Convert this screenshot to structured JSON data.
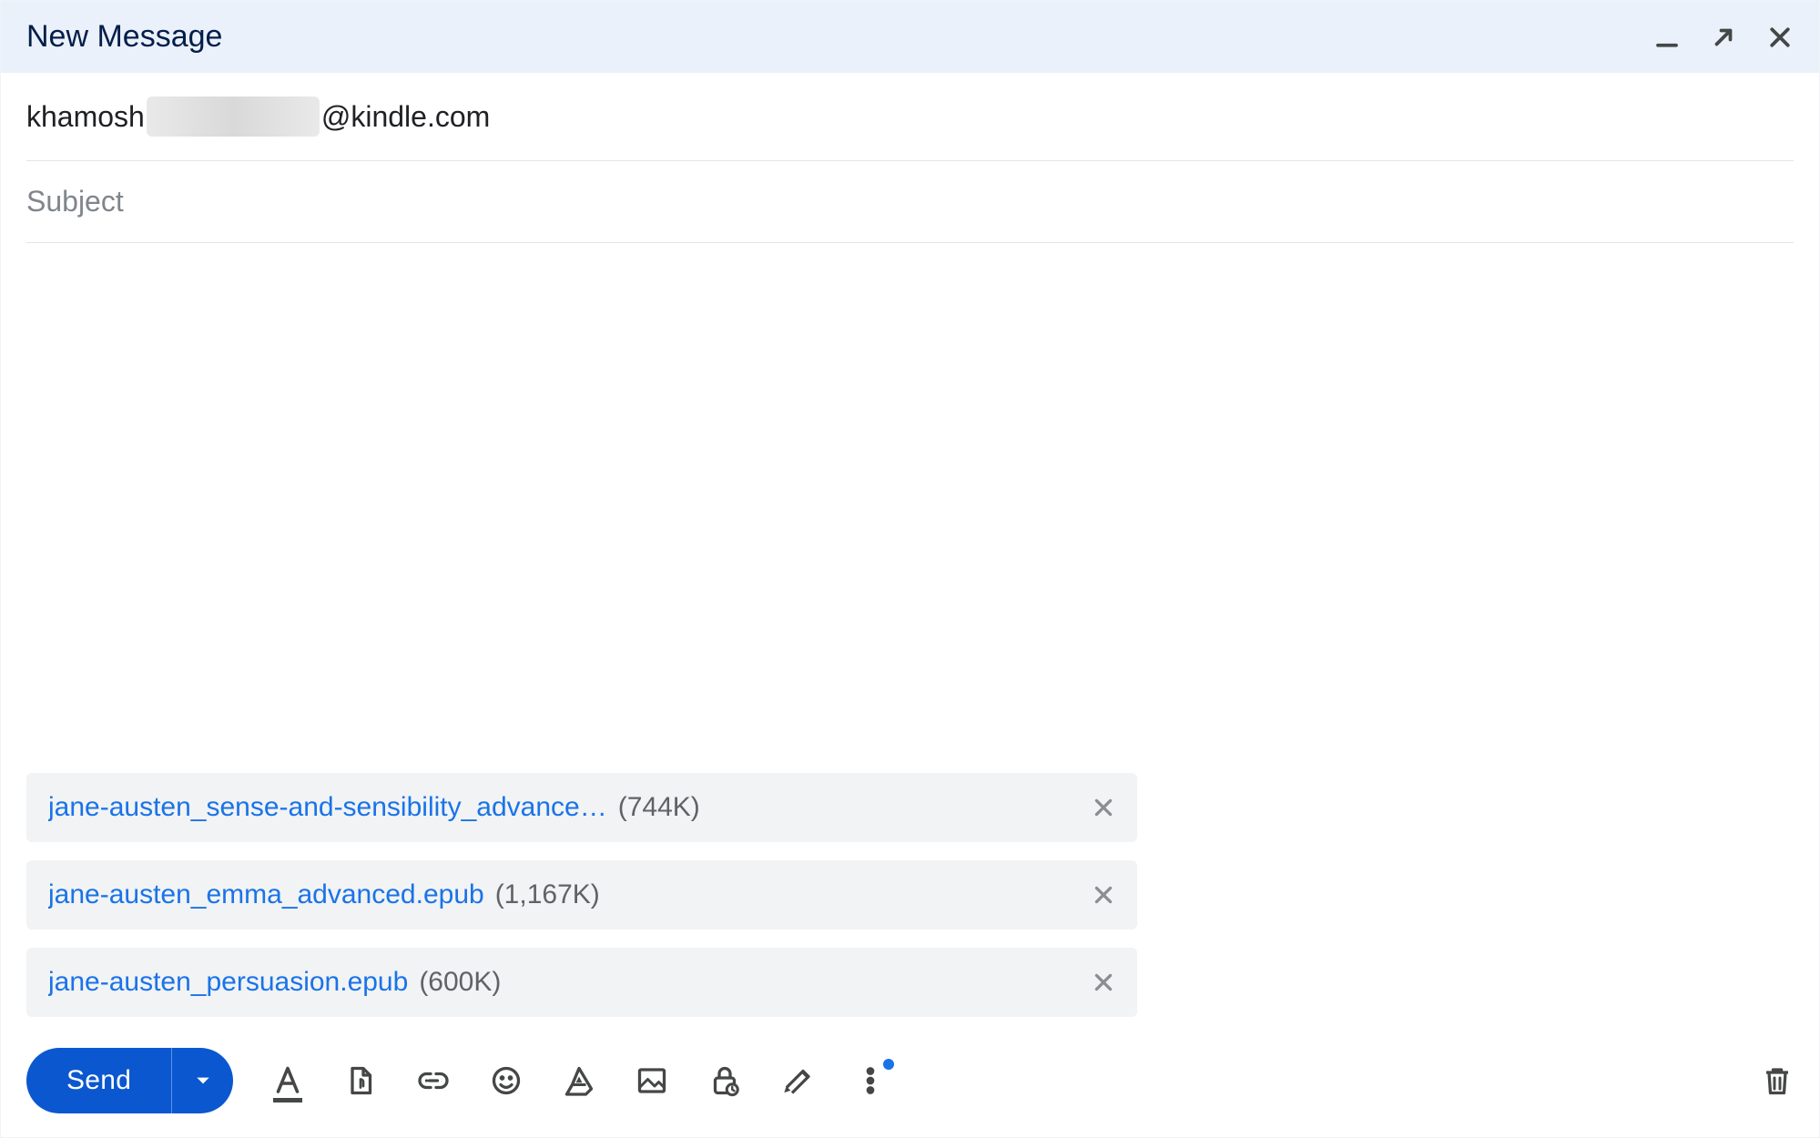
{
  "header": {
    "title": "New Message"
  },
  "fields": {
    "to_prefix": "khamosh",
    "to_suffix": "@kindle.com",
    "subject_placeholder": "Subject"
  },
  "attachments": [
    {
      "name": "jane-austen_sense-and-sensibility_advance…",
      "size": "(744K)"
    },
    {
      "name": "jane-austen_emma_advanced.epub",
      "size": "(1,167K)"
    },
    {
      "name": "jane-austen_persuasion.epub",
      "size": "(600K)"
    }
  ],
  "toolbar": {
    "send_label": "Send"
  },
  "icons": {
    "minimize": "minimize-icon",
    "popout": "popout-icon",
    "close": "close-icon",
    "formatting": "formatting-icon",
    "attach": "attach-file-icon",
    "link": "insert-link-icon",
    "emoji": "emoji-icon",
    "drive": "drive-icon",
    "photo": "insert-photo-icon",
    "confidential": "confidential-mode-icon",
    "signature": "insert-signature-icon",
    "more": "more-options-icon",
    "discard": "discard-draft-icon"
  }
}
